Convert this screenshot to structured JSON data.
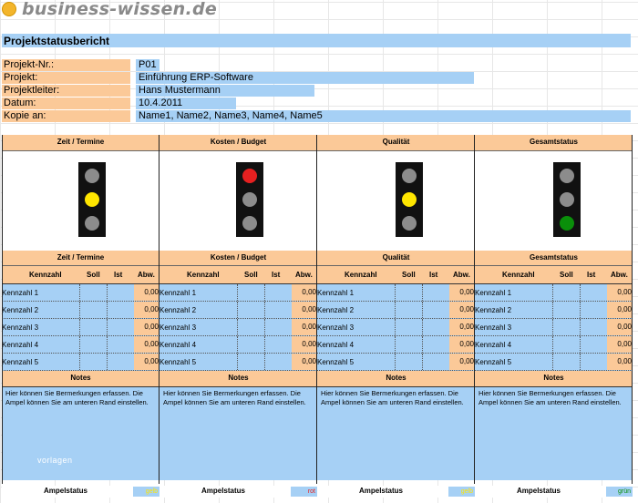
{
  "logo": {
    "text": "business-wissen.de"
  },
  "report_title": "Projektstatusbericht",
  "info": [
    {
      "label": "Projekt-Nr.:",
      "value": "P01"
    },
    {
      "label": "Projekt:",
      "value": "Einführung ERP-Software"
    },
    {
      "label": "Projektleiter:",
      "value": "Hans Mustermann"
    },
    {
      "label": "Datum:",
      "value": "10.4.2011"
    },
    {
      "label": "Kopie an:",
      "value": "Name1, Name2, Name3, Name4, Name5"
    }
  ],
  "table_headers": {
    "kennzahl": "Kennzahl",
    "soll": "Soll",
    "ist": "Ist",
    "abw": "Abw."
  },
  "notes_label": "Notes",
  "ampel_label": "Ampelstatus",
  "colors": {
    "orange": "#fbc998",
    "blue": "#a6d0f5",
    "red": "#e62020",
    "yellow": "#ffe600",
    "green": "#0a8f0a",
    "off": "#8c8c8c"
  },
  "panels": [
    {
      "title": "Zeit / Termine",
      "active_light": "yellow",
      "rows": [
        {
          "name": "Kennzahl 1",
          "abw": "0,00"
        },
        {
          "name": "Kennzahl 2",
          "abw": "0,00"
        },
        {
          "name": "Kennzahl 3",
          "abw": "0,00"
        },
        {
          "name": "Kennzahl 4",
          "abw": "0,00"
        },
        {
          "name": "Kennzahl 5",
          "abw": "0,00"
        }
      ],
      "notes": "Hier können Sie Bermerkungen erfassen. Die Ampel können Sie am unteren Rand einstellen.",
      "status": "gelb"
    },
    {
      "title": "Kosten / Budget",
      "active_light": "red",
      "rows": [
        {
          "name": "Kennzahl 1",
          "abw": "0,00"
        },
        {
          "name": "Kennzahl 2",
          "abw": "0,00"
        },
        {
          "name": "Kennzahl 3",
          "abw": "0,00"
        },
        {
          "name": "Kennzahl 4",
          "abw": "0,00"
        },
        {
          "name": "Kennzahl 5",
          "abw": "0,00"
        }
      ],
      "notes": "Hier können Sie Bermerkungen erfassen. Die Ampel können Sie am unteren Rand einstellen.",
      "status": "rot"
    },
    {
      "title": "Qualität",
      "active_light": "yellow",
      "rows": [
        {
          "name": "Kennzahl 1",
          "abw": "0,00"
        },
        {
          "name": "Kennzahl 2",
          "abw": "0,00"
        },
        {
          "name": "Kennzahl 3",
          "abw": "0,00"
        },
        {
          "name": "Kennzahl 4",
          "abw": "0,00"
        },
        {
          "name": "Kennzahl 5",
          "abw": "0,00"
        }
      ],
      "notes": "Hier können Sie Bermerkungen erfassen. Die Ampel können Sie am unteren Rand einstellen.",
      "status": "gelb"
    },
    {
      "title": "Gesamtstatus",
      "active_light": "green",
      "rows": [
        {
          "name": "Kennzahl 1",
          "abw": "0,00"
        },
        {
          "name": "Kennzahl 2",
          "abw": "0,00"
        },
        {
          "name": "Kennzahl 3",
          "abw": "0,00"
        },
        {
          "name": "Kennzahl 4",
          "abw": "0,00"
        },
        {
          "name": "Kennzahl 5",
          "abw": "0,00"
        }
      ],
      "notes": "Hier können Sie Bermerkungen erfassen. Die Ampel können Sie am unteren Rand einstellen.",
      "status": "grün"
    }
  ],
  "watermark": "vorlagen"
}
